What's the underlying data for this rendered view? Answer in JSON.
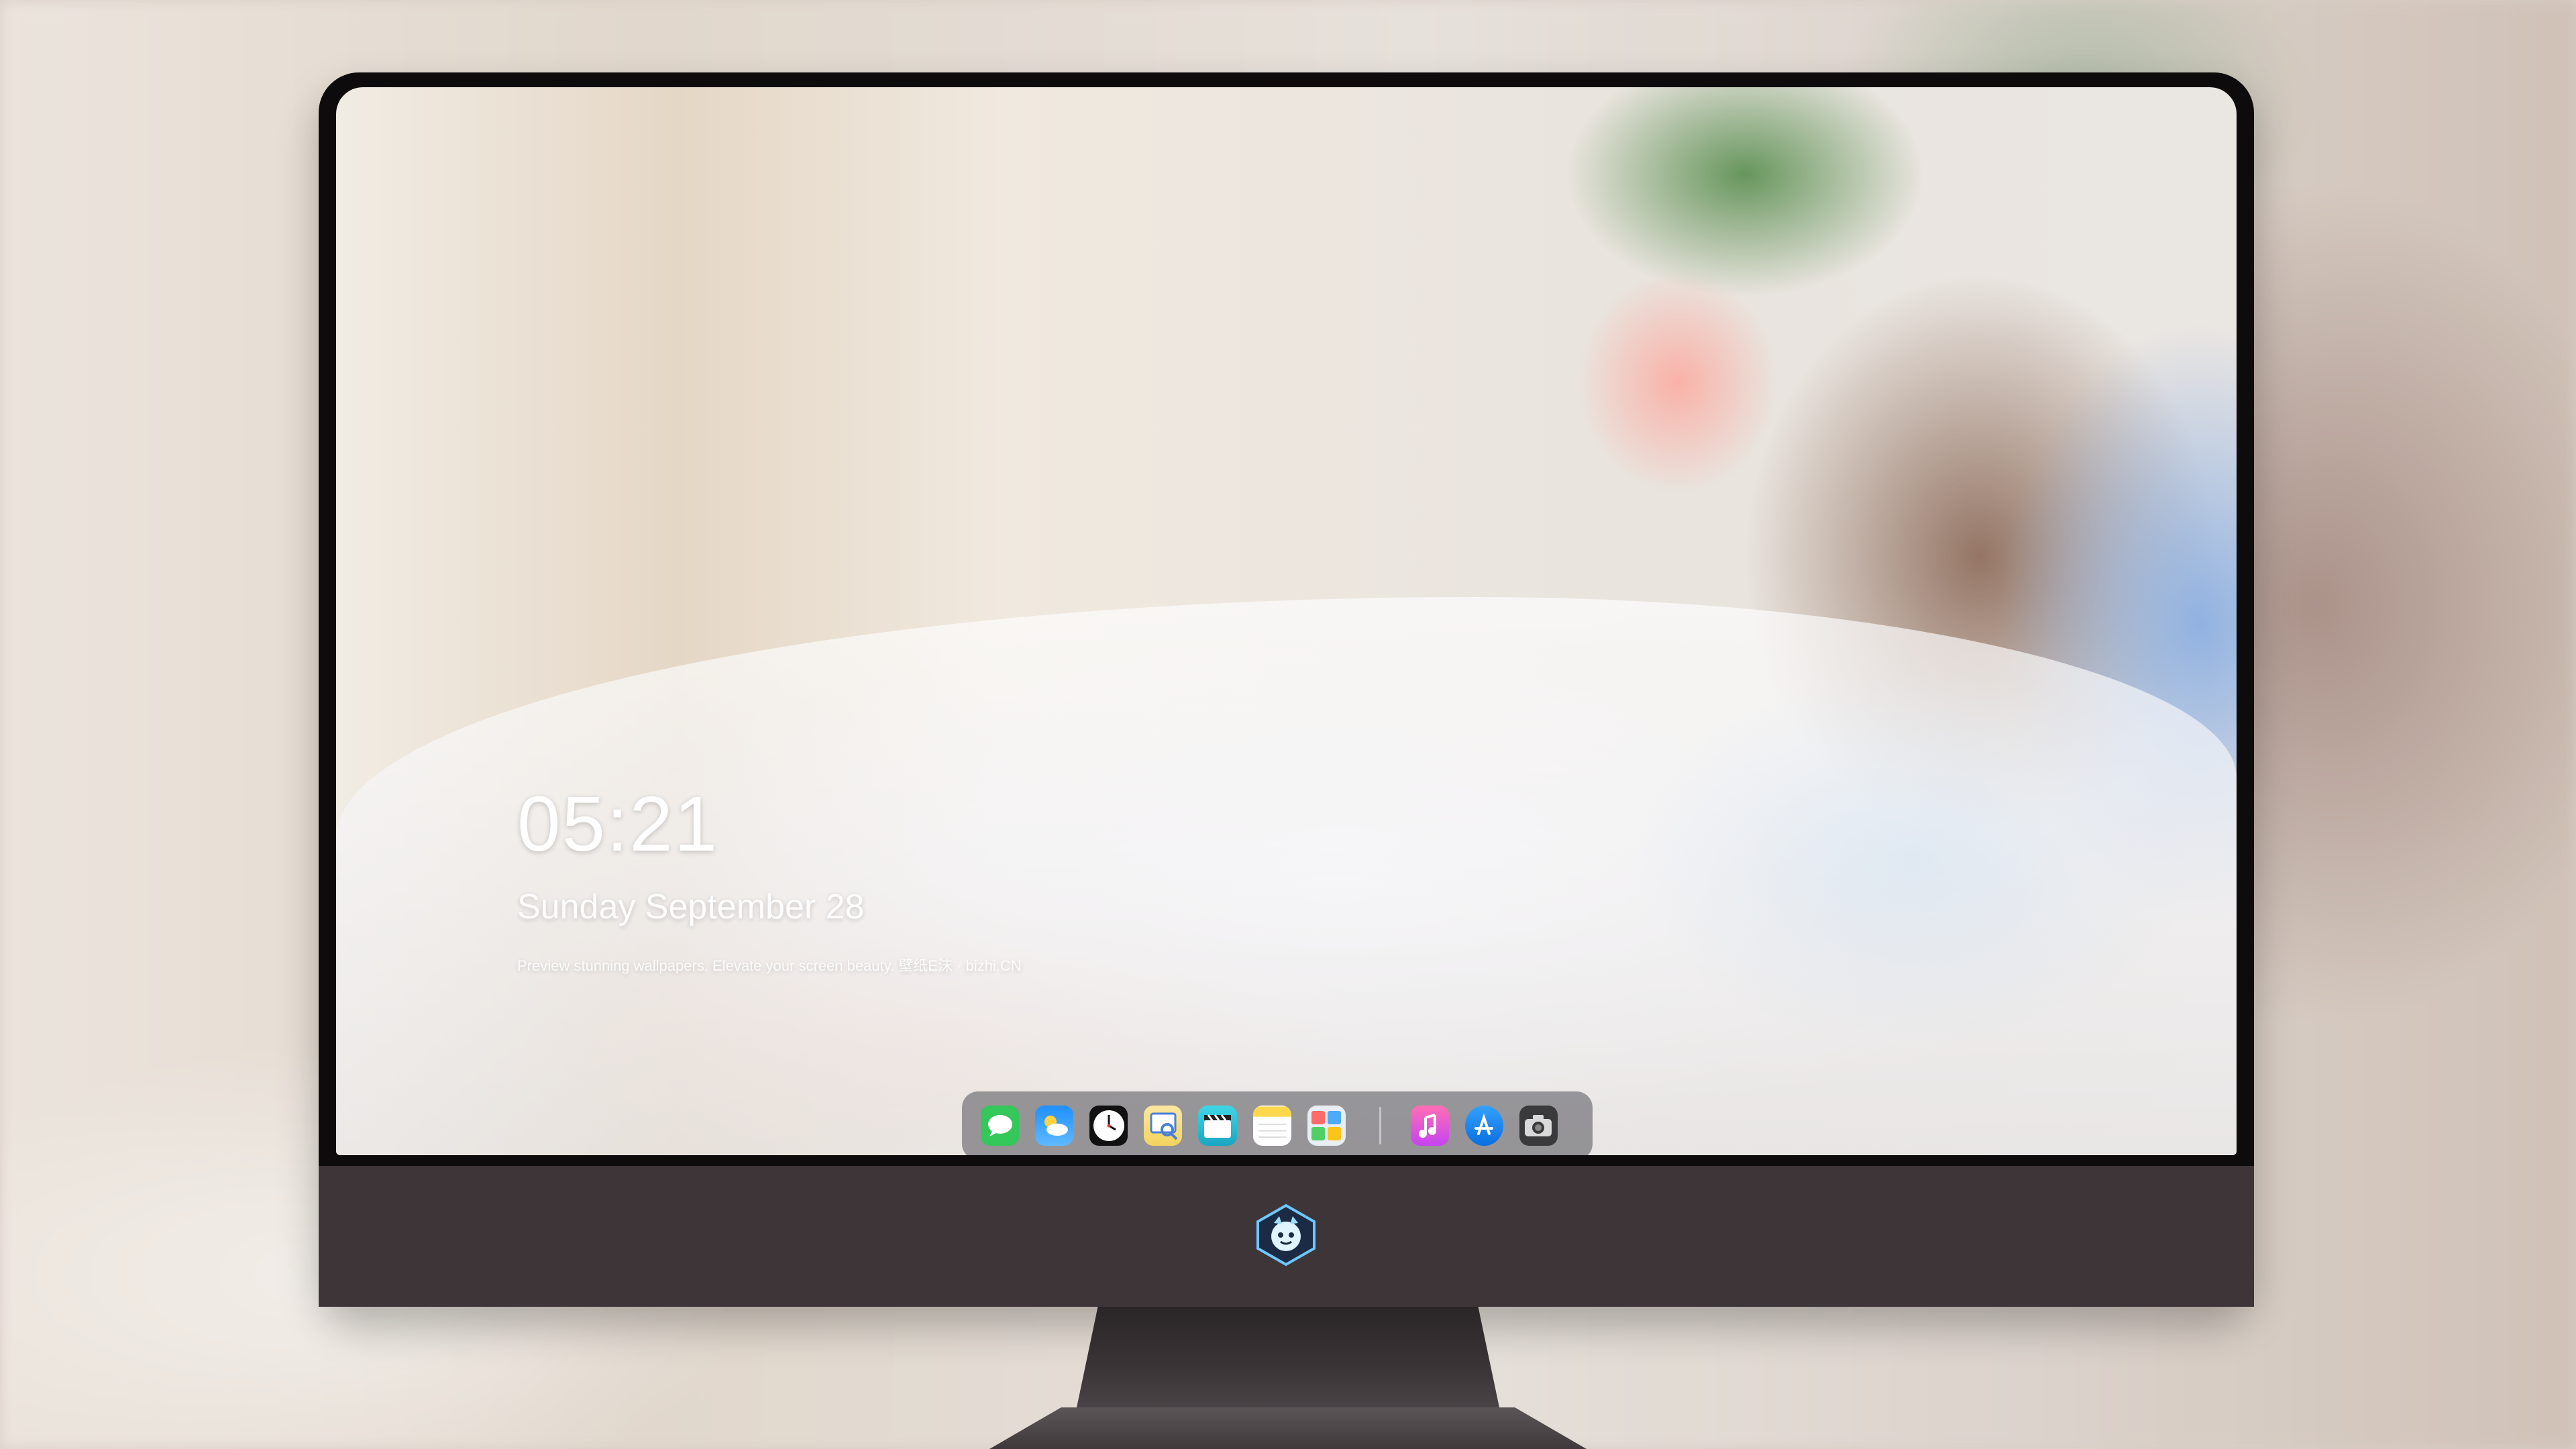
{
  "lock_screen": {
    "time": "05:21",
    "date": "Sunday September  28",
    "tagline": "Preview stunning wallpapers. Elevate your screen beauty. 壁纸E沫 · bizhi.CN"
  },
  "dock": {
    "apps": [
      {
        "id": "messages",
        "icon": "messages-icon",
        "color": "#34c759"
      },
      {
        "id": "weather",
        "icon": "weather-icon",
        "color": "#1e90ff"
      },
      {
        "id": "clock",
        "icon": "clock-icon",
        "color": "#111111"
      },
      {
        "id": "preview",
        "icon": "preview-icon",
        "color": "#f4d35e"
      },
      {
        "id": "clips",
        "icon": "clips-icon",
        "color": "#2ec4d6"
      },
      {
        "id": "notes",
        "icon": "notes-icon",
        "color": "#ffd84d"
      },
      {
        "id": "photos",
        "icon": "photos-icon",
        "color": "#e9eef4"
      },
      {
        "id": "music",
        "icon": "music-icon",
        "color": "#f25ab0"
      },
      {
        "id": "app-store",
        "icon": "app-store-icon",
        "color": "#1a8cff"
      },
      {
        "id": "camera",
        "icon": "camera-icon",
        "color": "#3a3a3c"
      }
    ]
  },
  "monitor": {
    "logo": "mascot-logo-icon",
    "bezel_color": "#3d3538"
  }
}
